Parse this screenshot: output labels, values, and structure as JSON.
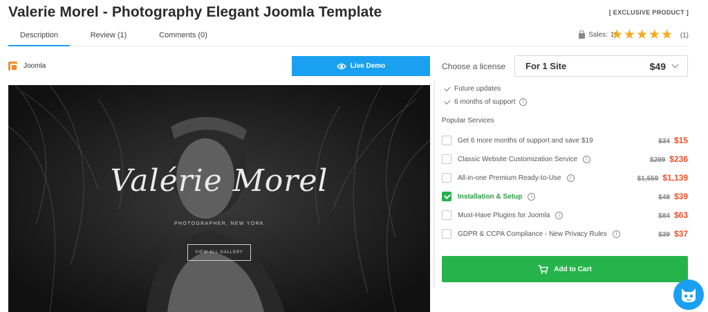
{
  "header": {
    "title": "Valerie Morel - Photography Elegant Joomla Template",
    "badge": "[ EXCLUSIVE PRODUCT ]"
  },
  "tabs": [
    {
      "label": "Description",
      "active": true
    },
    {
      "label": "Review (1)",
      "active": false
    },
    {
      "label": "Comments (0)",
      "active": false
    }
  ],
  "stats": {
    "sales_label": "Sales:",
    "sales_count": "12",
    "rating_stars": 5,
    "rating_count": "(1)",
    "star_color": "#f6ab1a"
  },
  "platform": {
    "label": "Joomla",
    "icon": "joomla-icon"
  },
  "live_demo": {
    "label": "Live Demo",
    "icon": "eye-icon",
    "color": "#1aa0f0"
  },
  "preview": {
    "heading": "Valérie Morel",
    "subtitle": "PHOTOGRAPHER, NEW YORK",
    "button": "VIEW ALL GALLERY"
  },
  "license": {
    "label": "Choose a license",
    "selected": "For 1 Site",
    "price": "$49"
  },
  "features": [
    {
      "label": "Future updates",
      "info": false
    },
    {
      "label": "6 months of support",
      "info": true
    }
  ],
  "popular_services": {
    "title": "Popular Services",
    "items": [
      {
        "label": "Get 6 more months of support and save $19",
        "old": "$34",
        "new": "$15",
        "checked": false,
        "info": false
      },
      {
        "label": "Classic Website Customization Service",
        "old": "$299",
        "new": "$236",
        "checked": false,
        "info": true
      },
      {
        "label": "All-in-one Premium Ready-to-Use",
        "old": "$1,559",
        "new": "$1,139",
        "checked": false,
        "info": true
      },
      {
        "label": "Installation & Setup",
        "old": "$49",
        "new": "$39",
        "checked": true,
        "info": true
      },
      {
        "label": "Must-Have Plugins for Joomla",
        "old": "$84",
        "new": "$63",
        "checked": false,
        "info": true
      },
      {
        "label": "GDPR & CCPA Compliance - New Privacy Rules",
        "old": "$39",
        "new": "$37",
        "checked": false,
        "info": true
      }
    ]
  },
  "cart": {
    "label": "Add to Cart",
    "icon": "cart-icon",
    "color": "#26b34b"
  },
  "chat": {
    "icon": "chat-mascot-icon",
    "color": "#1aa0f0"
  }
}
